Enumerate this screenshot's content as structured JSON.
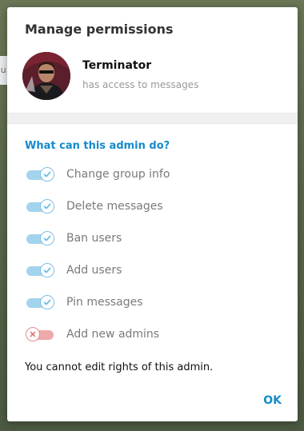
{
  "backdrop": {
    "peek_text": "ou"
  },
  "dialog": {
    "title": "Manage permissions"
  },
  "user": {
    "name": "Terminator",
    "status": "has access to messages",
    "avatar_icon": "user-avatar-photo"
  },
  "section": {
    "title": "What can this admin do?"
  },
  "permissions": [
    {
      "label": "Change group info",
      "enabled": true
    },
    {
      "label": "Delete messages",
      "enabled": true
    },
    {
      "label": "Ban users",
      "enabled": true
    },
    {
      "label": "Add users",
      "enabled": true
    },
    {
      "label": "Pin messages",
      "enabled": true
    },
    {
      "label": "Add new admins",
      "enabled": false
    }
  ],
  "note": "You cannot edit rights of this admin.",
  "ok_label": "OK",
  "colors": {
    "accent": "#168acd",
    "toggle_on": "#a3d4ee",
    "toggle_off": "#f0a9a9"
  }
}
